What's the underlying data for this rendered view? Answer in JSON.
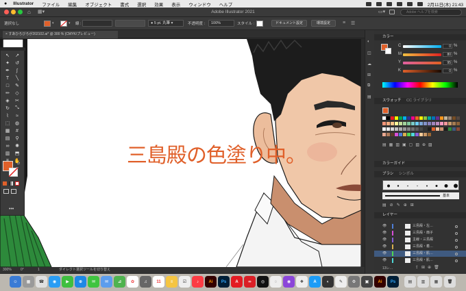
{
  "menubar": {
    "apple": "",
    "app_name": "Illustrator",
    "items": [
      "ファイル",
      "編集",
      "オブジェクト",
      "書式",
      "選択",
      "効果",
      "表示",
      "ウィンドウ",
      "ヘルプ"
    ],
    "clock": "2月11日(木) 21:43"
  },
  "window": {
    "title": "Adobe Illustrator 2021",
    "search_placeholder": "Adobe ヘルプを検索"
  },
  "controlbar": {
    "selection": "選択なし",
    "stroke_label": "線 :",
    "brush": "5 pt. 丸筆",
    "opacity_label": "不透明度 :",
    "opacity": "100%",
    "style_label": "スタイル :",
    "doc_settings": "ドキュメント設定",
    "env_settings": "環境設定"
  },
  "document": {
    "tab_title": "すあひろびろが202102.ai* @ 300 % (CMYK/プレビュー)"
  },
  "canvas": {
    "overlay_text": "三島殿の色塗り中。"
  },
  "status": {
    "zoom": "300%",
    "angle": "0°",
    "page": "1",
    "tool_hint": "ダイレクト選択ツールを切り替え"
  },
  "color_panel": {
    "title": "カラー",
    "channels": [
      {
        "label": "C",
        "value": "0",
        "unit": "%"
      },
      {
        "label": "M",
        "value": "80",
        "unit": "%"
      },
      {
        "label": "Y",
        "value": "95",
        "unit": "%"
      },
      {
        "label": "K",
        "value": "0",
        "unit": "%"
      }
    ]
  },
  "swatches_panel": {
    "tabs": [
      "スウォッチ",
      "CC ライブラリ"
    ]
  },
  "color_guide": {
    "title": "カラーガイド"
  },
  "brush_panel": {
    "tabs": [
      "ブラシ",
      "シンボル"
    ],
    "basic_label": "基本"
  },
  "layers_panel": {
    "title": "レイヤー",
    "layers": [
      {
        "name": "三島殿・左…",
        "color": "#4f7fd9"
      },
      {
        "name": "三島殿・扇子",
        "color": "#d94fd9"
      },
      {
        "name": "主線・三島殿",
        "color": "#8a5fd9"
      },
      {
        "name": "三島殿・着…",
        "color": "#d9b04f"
      },
      {
        "name": "三島殿・肌…",
        "color": "#4fd94f",
        "selected": true
      },
      {
        "name": "三島殿・肌…",
        "color": "#4fd9d9"
      }
    ],
    "footer": "13レ…"
  },
  "colors": {
    "accent_orange": "#e0602a",
    "panel_bg": "#323232"
  },
  "dock": {
    "badge": "11"
  }
}
